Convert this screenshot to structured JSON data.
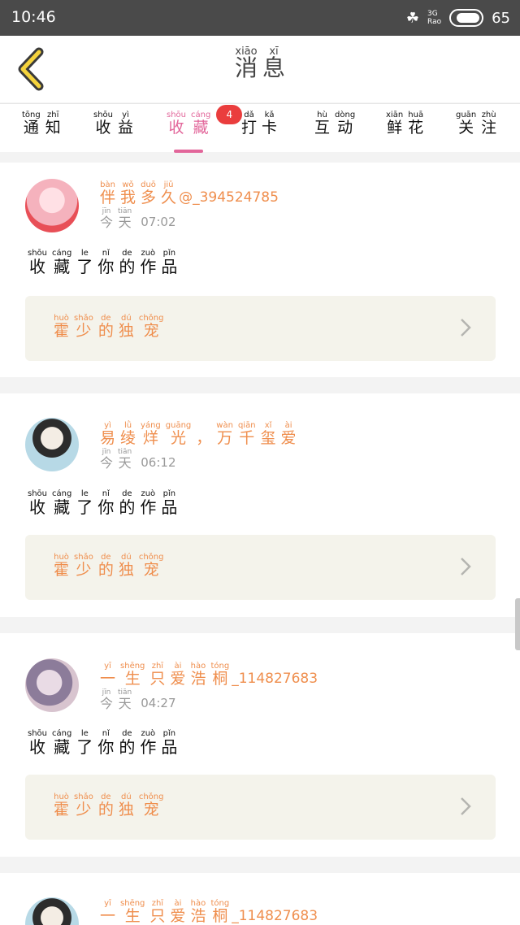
{
  "status_bar": {
    "time": "10:46",
    "network": "3G",
    "network_sub": "Rao",
    "battery": "65"
  },
  "header": {
    "title": [
      {
        "c": "消",
        "p": "xiāo"
      },
      {
        "c": "息",
        "p": "xī"
      }
    ]
  },
  "tabs": [
    {
      "label": [
        {
          "c": "通",
          "p": "tōng"
        },
        {
          "c": "知",
          "p": "zhī"
        }
      ],
      "active": false
    },
    {
      "label": [
        {
          "c": "收",
          "p": "shōu"
        },
        {
          "c": "益",
          "p": "yì"
        }
      ],
      "active": false
    },
    {
      "label": [
        {
          "c": "收",
          "p": "shōu"
        },
        {
          "c": "藏",
          "p": "cáng"
        }
      ],
      "active": true,
      "badge": "4"
    },
    {
      "label": [
        {
          "c": "打",
          "p": "dǎ"
        },
        {
          "c": "卡",
          "p": "kǎ"
        }
      ],
      "active": false
    },
    {
      "label": [
        {
          "c": "互",
          "p": "hù"
        },
        {
          "c": "动",
          "p": "dòng"
        }
      ],
      "active": false
    },
    {
      "label": [
        {
          "c": "鲜",
          "p": "xiān"
        },
        {
          "c": "花",
          "p": "huā"
        }
      ],
      "active": false
    },
    {
      "label": [
        {
          "c": "关",
          "p": "guān"
        },
        {
          "c": "注",
          "p": "zhù"
        }
      ],
      "active": false
    }
  ],
  "messages": [
    {
      "name_chars": [
        {
          "c": "伴",
          "p": "bàn"
        },
        {
          "c": "我",
          "p": "wǒ"
        },
        {
          "c": "多",
          "p": "duō"
        },
        {
          "c": "久",
          "p": "jiǔ"
        }
      ],
      "name_suffix": "@_394524785",
      "day": [
        {
          "c": "今",
          "p": "jīn"
        },
        {
          "c": "天",
          "p": "tiān"
        }
      ],
      "time": "07:02",
      "action": [
        {
          "c": "收",
          "p": "shōu"
        },
        {
          "c": "藏",
          "p": "cáng"
        },
        {
          "c": "了",
          "p": "le"
        },
        {
          "c": "你",
          "p": "nǐ"
        },
        {
          "c": "的",
          "p": "de"
        },
        {
          "c": "作",
          "p": "zuò"
        },
        {
          "c": "品",
          "p": "pǐn"
        }
      ],
      "work": [
        {
          "c": "霍",
          "p": "huò"
        },
        {
          "c": "少",
          "p": "shǎo"
        },
        {
          "c": "的",
          "p": "de"
        },
        {
          "c": "独",
          "p": "dú"
        },
        {
          "c": "宠",
          "p": "chǒng"
        }
      ]
    },
    {
      "name_chars": [
        {
          "c": "易",
          "p": "yì"
        },
        {
          "c": "绫",
          "p": "lǜ"
        },
        {
          "c": "烊",
          "p": "yáng"
        },
        {
          "c": "光",
          "p": "guāng"
        },
        {
          "c": "，",
          "p": ""
        },
        {
          "c": "万",
          "p": "wàn"
        },
        {
          "c": "千",
          "p": "qiān"
        },
        {
          "c": "玺",
          "p": "xǐ"
        },
        {
          "c": "爱",
          "p": "ài"
        }
      ],
      "name_suffix": "",
      "day": [
        {
          "c": "今",
          "p": "jīn"
        },
        {
          "c": "天",
          "p": "tiān"
        }
      ],
      "time": "06:12",
      "action": [
        {
          "c": "收",
          "p": "shōu"
        },
        {
          "c": "藏",
          "p": "cáng"
        },
        {
          "c": "了",
          "p": "le"
        },
        {
          "c": "你",
          "p": "nǐ"
        },
        {
          "c": "的",
          "p": "de"
        },
        {
          "c": "作",
          "p": "zuò"
        },
        {
          "c": "品",
          "p": "pǐn"
        }
      ],
      "work": [
        {
          "c": "霍",
          "p": "huò"
        },
        {
          "c": "少",
          "p": "shǎo"
        },
        {
          "c": "的",
          "p": "de"
        },
        {
          "c": "独",
          "p": "dú"
        },
        {
          "c": "宠",
          "p": "chǒng"
        }
      ]
    },
    {
      "name_chars": [
        {
          "c": "一",
          "p": "yī"
        },
        {
          "c": "生",
          "p": "shēng"
        },
        {
          "c": "只",
          "p": "zhī"
        },
        {
          "c": "爱",
          "p": "ài"
        },
        {
          "c": "浩",
          "p": "hào"
        },
        {
          "c": "桐",
          "p": "tóng"
        }
      ],
      "name_suffix": "_114827683",
      "day": [
        {
          "c": "今",
          "p": "jīn"
        },
        {
          "c": "天",
          "p": "tiān"
        }
      ],
      "time": "04:27",
      "action": [
        {
          "c": "收",
          "p": "shōu"
        },
        {
          "c": "藏",
          "p": "cáng"
        },
        {
          "c": "了",
          "p": "le"
        },
        {
          "c": "你",
          "p": "nǐ"
        },
        {
          "c": "的",
          "p": "de"
        },
        {
          "c": "作",
          "p": "zuò"
        },
        {
          "c": "品",
          "p": "pǐn"
        }
      ],
      "work": [
        {
          "c": "霍",
          "p": "huò"
        },
        {
          "c": "少",
          "p": "shǎo"
        },
        {
          "c": "的",
          "p": "de"
        },
        {
          "c": "独",
          "p": "dú"
        },
        {
          "c": "宠",
          "p": "chǒng"
        }
      ]
    },
    {
      "name_chars": [
        {
          "c": "一",
          "p": "yī"
        },
        {
          "c": "生",
          "p": "shēng"
        },
        {
          "c": "只",
          "p": "zhī"
        },
        {
          "c": "爱",
          "p": "ài"
        },
        {
          "c": "浩",
          "p": "hào"
        },
        {
          "c": "桐",
          "p": "tóng"
        }
      ],
      "name_suffix": "_114827683"
    }
  ],
  "colors": {
    "accent": "#e2669a",
    "name": "#ef8e4d",
    "badge": "#ea3d3d",
    "work_bg": "#f4f3eb"
  }
}
